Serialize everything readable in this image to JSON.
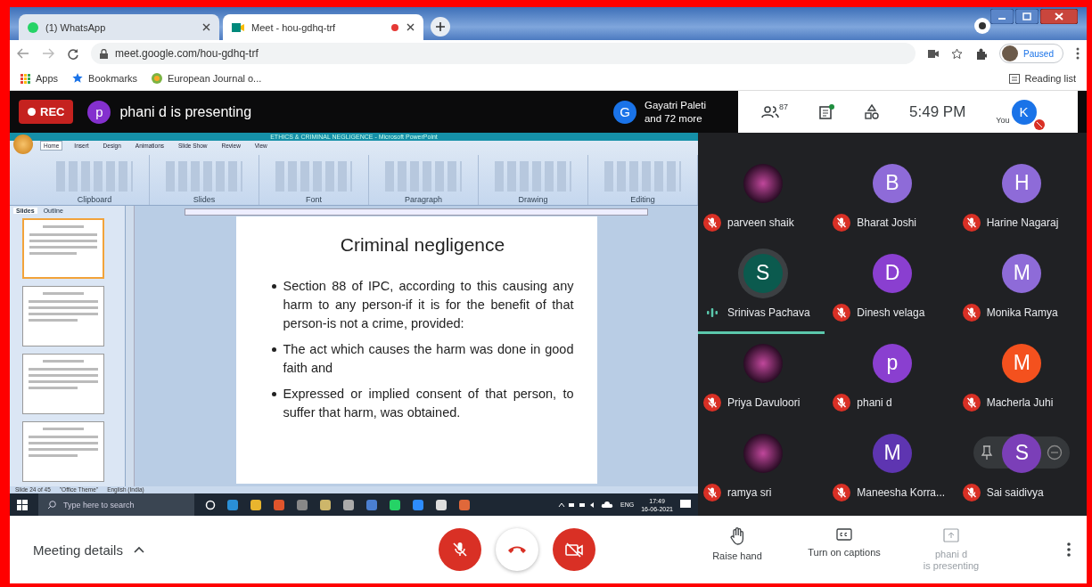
{
  "browser": {
    "tabs": [
      {
        "title": "(1) WhatsApp",
        "selected": false,
        "recording": false
      },
      {
        "title": "Meet - hou-gdhq-trf",
        "selected": true,
        "recording": true
      }
    ],
    "url": "meet.google.com/hou-gdhq-trf",
    "profile_status": "Paused",
    "bookmarks": [
      "Apps",
      "Bookmarks",
      "European Journal o..."
    ],
    "reading_list": "Reading list"
  },
  "meet_bar": {
    "rec_label": "REC",
    "presenter_initial": "p",
    "presenter_text": "phani d is presenting",
    "others_initial": "G",
    "others_name": "Gayatri Paleti",
    "others_more": "and 72 more",
    "participant_count": "87",
    "time": "5:49 PM",
    "you_label": "You",
    "you_initial": "K"
  },
  "shared_screen": {
    "window_title": "ETHICS & CRIMINAL NEGLIGENCE - Microsoft PowerPoint",
    "ribbon_tabs": [
      {
        "label": "Home",
        "selected": true
      },
      {
        "label": "Insert",
        "selected": false
      },
      {
        "label": "Design",
        "selected": false
      },
      {
        "label": "Animations",
        "selected": false
      },
      {
        "label": "Slide Show",
        "selected": false
      },
      {
        "label": "Review",
        "selected": false
      },
      {
        "label": "View",
        "selected": false
      }
    ],
    "ribbon_groups": [
      "Clipboard",
      "Slides",
      "Font",
      "Paragraph",
      "Drawing",
      "Editing"
    ],
    "pane_tabs": [
      {
        "label": "Slides",
        "selected": true
      },
      {
        "label": "Outline",
        "selected": false
      }
    ],
    "thumbnails": [
      {
        "selected": true
      },
      {
        "selected": false
      },
      {
        "selected": false
      },
      {
        "selected": false
      }
    ],
    "slide": {
      "title": "Criminal negligence",
      "bullets": [
        "Section 88 of IPC, according to this causing any harm to any person-if it is for the benefit of that person-is not a crime, provided:",
        "The act which causes the harm was done in good faith and",
        "Expressed or implied consent of that person, to suffer that harm, was obtained."
      ]
    },
    "status": [
      "Slide 24 of 45",
      "\"Office Theme\"",
      "English (India)"
    ],
    "taskbar": {
      "search_placeholder": "Type here to search",
      "language": "ENG",
      "time": "17:49",
      "date": "16-06-2021"
    }
  },
  "participants": [
    {
      "name": "parveen shaik",
      "kind": "photo",
      "muted": true,
      "speaking": false,
      "hovered": false
    },
    {
      "name": "Bharat Joshi",
      "kind": "letter",
      "initial": "B",
      "color": "#8e6bd8",
      "muted": true,
      "speaking": false,
      "hovered": false
    },
    {
      "name": "Harine Nagaraj",
      "kind": "letter",
      "initial": "H",
      "color": "#8e6bd8",
      "muted": true,
      "speaking": false,
      "hovered": false
    },
    {
      "name": "Srinivas Pachava",
      "kind": "letter",
      "initial": "S",
      "color": "#0b5a4e",
      "muted": false,
      "speaking": true,
      "hovered": false
    },
    {
      "name": "Dinesh velaga",
      "kind": "letter",
      "initial": "D",
      "color": "#8a3fd0",
      "muted": true,
      "speaking": false,
      "hovered": false
    },
    {
      "name": "Monika Ramya",
      "kind": "letter",
      "initial": "M",
      "color": "#8e6bd8",
      "muted": true,
      "speaking": false,
      "hovered": false
    },
    {
      "name": "Priya Davuloori",
      "kind": "photo",
      "muted": true,
      "speaking": false,
      "hovered": false
    },
    {
      "name": "phani d",
      "kind": "letter",
      "initial": "p",
      "color": "#8a3fd0",
      "muted": true,
      "speaking": false,
      "hovered": false
    },
    {
      "name": "Macherla Juhi",
      "kind": "letter",
      "initial": "M",
      "color": "#f4511e",
      "muted": true,
      "speaking": false,
      "hovered": false
    },
    {
      "name": "ramya sri",
      "kind": "photo",
      "muted": true,
      "speaking": false,
      "hovered": false
    },
    {
      "name": "Maneesha Korra...",
      "kind": "letter",
      "initial": "M",
      "color": "#5e35b1",
      "muted": true,
      "speaking": false,
      "hovered": false
    },
    {
      "name": "Sai saidivya",
      "kind": "letter",
      "initial": "S",
      "color": "#7b3fb8",
      "muted": true,
      "speaking": false,
      "hovered": true
    }
  ],
  "bottom": {
    "meeting_details": "Meeting details",
    "controls": [
      {
        "kind": "mic",
        "on": false
      },
      {
        "kind": "leave"
      },
      {
        "kind": "camera",
        "on": false
      }
    ],
    "actions": [
      {
        "kind": "hand",
        "label": "Raise hand",
        "disabled": false
      },
      {
        "kind": "captions",
        "label": "Turn on captions",
        "disabled": false
      },
      {
        "kind": "present",
        "label": "phani d\nis presenting",
        "disabled": true
      }
    ]
  }
}
